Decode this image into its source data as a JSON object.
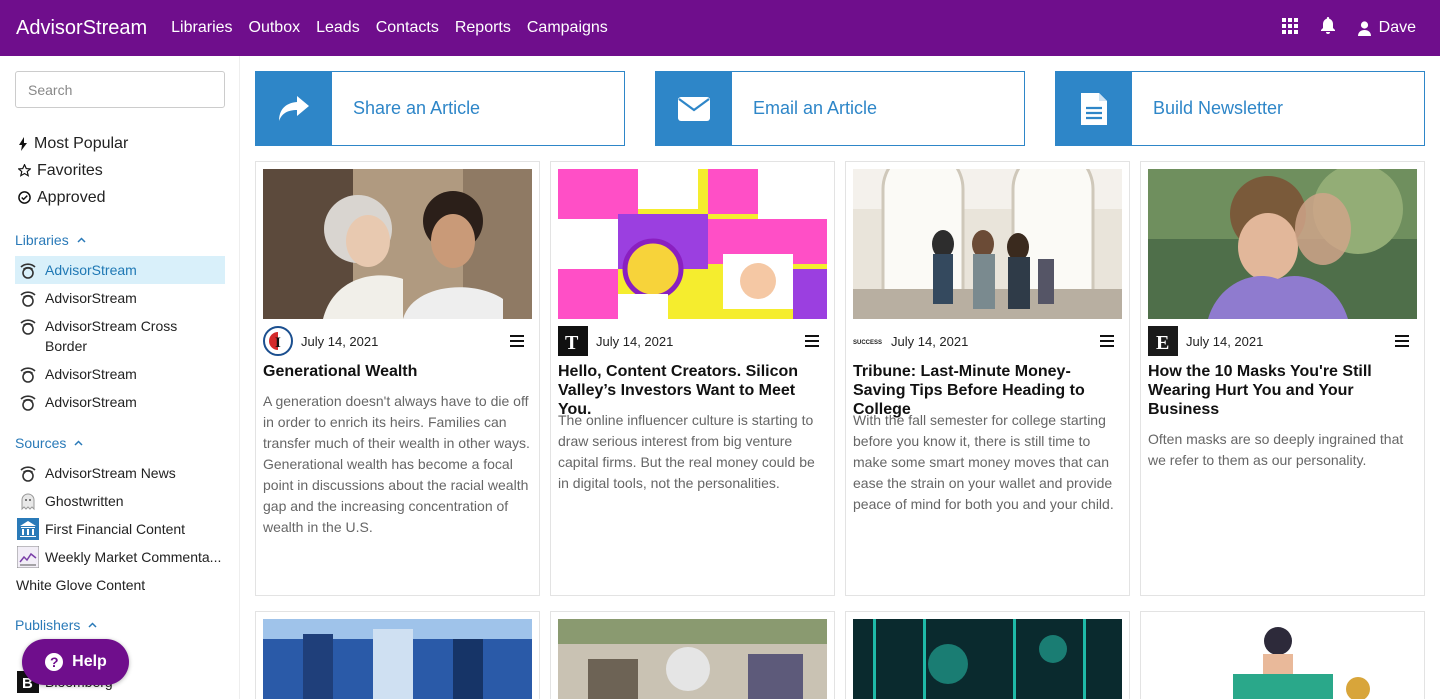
{
  "app": {
    "brand": "AdvisorStream"
  },
  "nav": {
    "items": [
      "Libraries",
      "Outbox",
      "Leads",
      "Contacts",
      "Reports",
      "Campaigns"
    ]
  },
  "user": {
    "name": "Dave"
  },
  "icons": {
    "apps": "grid-icon",
    "notifications": "bell-icon",
    "user": "user-icon"
  },
  "sidebar": {
    "search_placeholder": "Search",
    "quick": [
      "Most Popular",
      "Favorites",
      "Approved"
    ],
    "libraries_title": "Libraries",
    "libraries": [
      "AdvisorStream",
      "AdvisorStream",
      "AdvisorStream Cross Border",
      "AdvisorStream",
      "AdvisorStream"
    ],
    "sources_title": "Sources",
    "sources": [
      "AdvisorStream News",
      "Ghostwritten",
      "First Financial Content",
      "Weekly Market Commenta...",
      "White Glove Content"
    ],
    "publishers_title": "Publishers",
    "publishers": [
      "Bloomberg"
    ]
  },
  "help": {
    "label": "Help"
  },
  "actions": [
    "Share an Article",
    "Email an Article",
    "Build Newsletter"
  ],
  "cards": [
    {
      "date": "July 14, 2021",
      "title": "Generational Wealth",
      "body": "A generation doesn't always have to die off in order to enrich its heirs. Families can transfer much of their wealth in other ways. Generational wealth has become a focal point in discussions about the racial wealth gap and the increasing concentration of wealth in the U.S."
    },
    {
      "date": "July 14, 2021",
      "title": "Hello, Content Creators. Silicon Valley’s Investors Want to Meet You.",
      "body": "The online influencer culture is starting to draw serious interest from big venture capital firms. But the real money could be in digital tools, not the personalities."
    },
    {
      "date": "July 14, 2021",
      "title": "Tribune: Last-Minute Money-Saving Tips Before Heading to College",
      "body": "With the fall semester for college starting before you know it, there is still time to make some smart money moves that can ease the strain on your wallet and provide peace of mind for both you and your child."
    },
    {
      "date": "July 14, 2021",
      "title": "How the 10 Masks You're Still Wearing Hurt You and Your Business",
      "body": "Often masks are so deeply ingrained that we refer to them as our personality."
    }
  ],
  "publisher_marks": [
    "I",
    "T",
    "SUCCESS",
    "E"
  ]
}
